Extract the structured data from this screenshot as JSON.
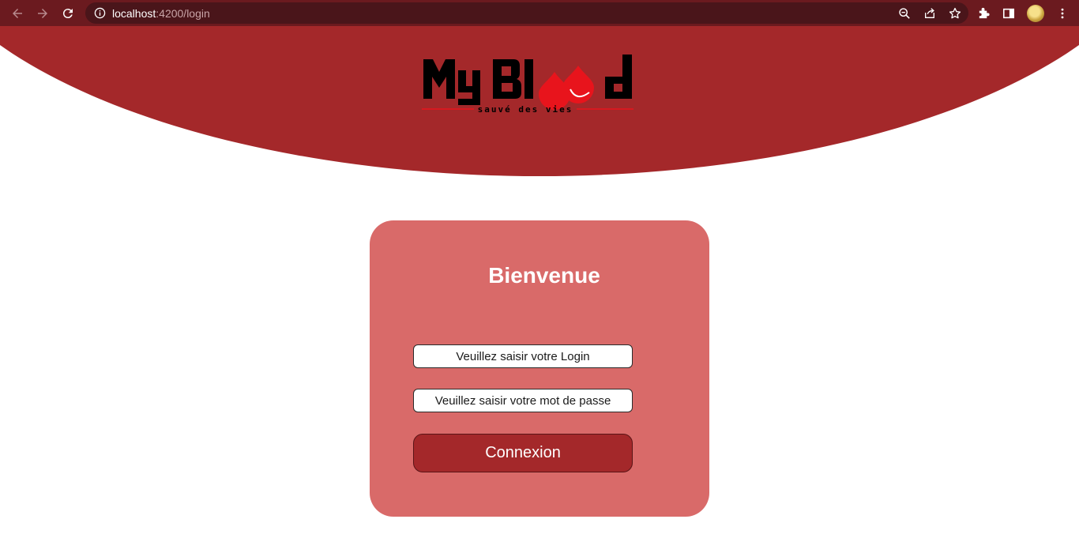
{
  "browser": {
    "url_host": "localhost",
    "url_path": ":4200/login"
  },
  "logo": {
    "text": "My Blood",
    "tagline": "sauvé des vies"
  },
  "login_card": {
    "title": "Bienvenue",
    "login_placeholder": "Veuillez saisir votre Login",
    "password_placeholder": "Veuillez saisir votre mot de passe",
    "submit_label": "Connexion"
  },
  "colors": {
    "chrome": "#6b1a1f",
    "header": "#a4282a",
    "card": "#d96a69",
    "button": "#a4282a",
    "drop": "#e8141c"
  }
}
